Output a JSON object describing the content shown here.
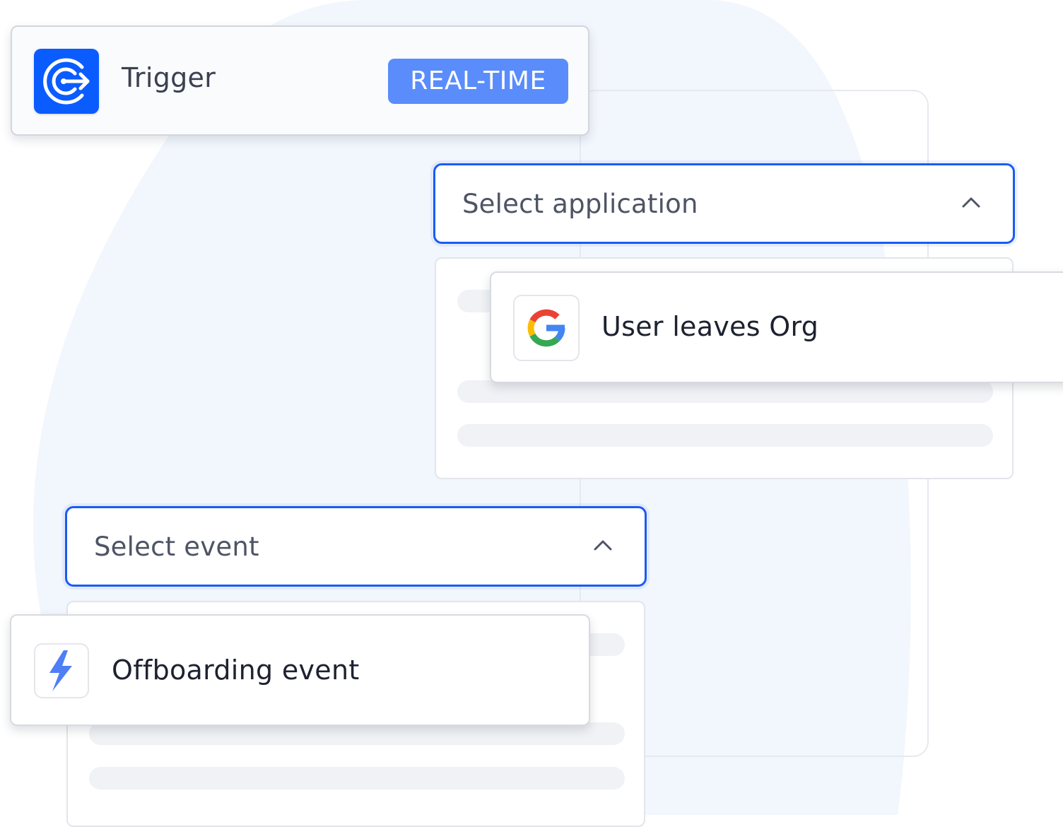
{
  "trigger": {
    "title": "Trigger",
    "badge": "REAL-TIME",
    "logo_icon": "target-arrow-icon",
    "logo_color": "#0b5cff"
  },
  "application_select": {
    "label": "Select application",
    "chevron_icon": "chevron-up-icon",
    "options": [
      {
        "label": "User leaves Org",
        "icon": "google-icon"
      }
    ]
  },
  "event_select": {
    "label": "Select event",
    "chevron_icon": "chevron-up-icon",
    "options": [
      {
        "label": "Offboarding event",
        "icon": "lightning-icon"
      }
    ]
  },
  "colors": {
    "accent": "#1a5cf0",
    "badge": "#5a8dfb",
    "background_blob": "#f2f6fd"
  }
}
